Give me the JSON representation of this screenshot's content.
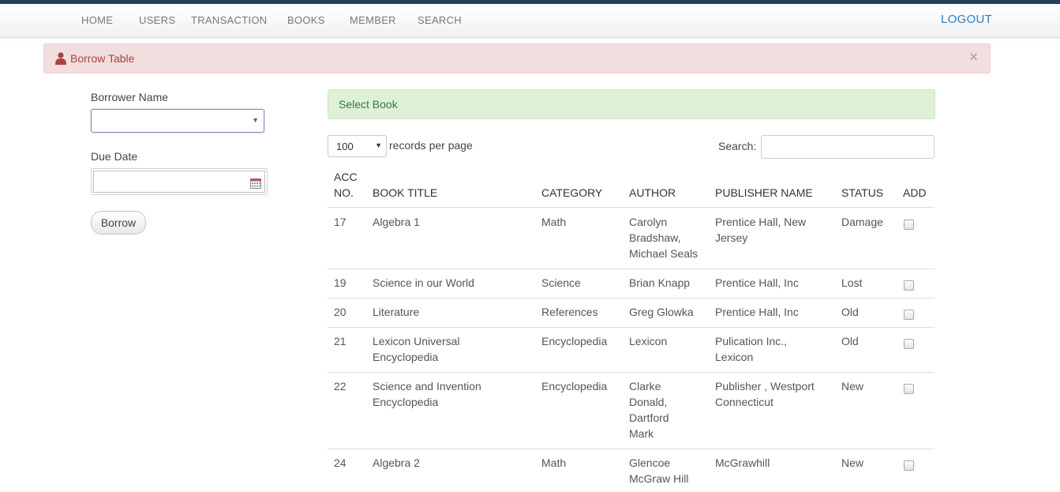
{
  "nav": {
    "home": "HOME",
    "users": "USERS",
    "transaction": "TRANSACTION",
    "books": "BOOKS",
    "member": "MEMBER",
    "search": "SEARCH",
    "logout": "LOGOUT"
  },
  "alert": {
    "title": "Borrow Table",
    "close": "×",
    "icon": "user-icon"
  },
  "form": {
    "borrower_label": "Borrower Name",
    "borrower_value": "",
    "due_label": "Due Date",
    "due_value": "",
    "borrow_button": "Borrow"
  },
  "select_book": {
    "title": "Select Book"
  },
  "table_controls": {
    "length_value": "100",
    "length_suffix": "records per page",
    "search_label": "Search:",
    "search_value": ""
  },
  "table": {
    "headers": {
      "acc_line1": "ACC",
      "acc_line2": "NO.",
      "title": "BOOK TITLE",
      "category": "CATEGORY",
      "author": "AUTHOR",
      "publisher": "PUBLISHER NAME",
      "status": "STATUS",
      "add": "ADD"
    },
    "rows": [
      {
        "acc": "17",
        "title": [
          "Algebra 1"
        ],
        "category": [
          "Math"
        ],
        "author": [
          "Carolyn",
          "Bradshaw,",
          "Michael Seals"
        ],
        "publisher": [
          "Prentice Hall, New",
          "Jersey"
        ],
        "status": "Damage",
        "checked": false
      },
      {
        "acc": "19",
        "title": [
          "Science in our World"
        ],
        "category": [
          "Science"
        ],
        "author": [
          "Brian Knapp"
        ],
        "publisher": [
          "Prentice Hall, Inc"
        ],
        "status": "Lost",
        "checked": false
      },
      {
        "acc": "20",
        "title": [
          "Literature"
        ],
        "category": [
          "References"
        ],
        "author": [
          "Greg Glowka"
        ],
        "publisher": [
          "Prentice Hall, Inc"
        ],
        "status": "Old",
        "checked": false
      },
      {
        "acc": "21",
        "title": [
          "Lexicon Universal",
          "Encyclopedia"
        ],
        "category": [
          "Encyclopedia"
        ],
        "author": [
          "Lexicon"
        ],
        "publisher": [
          "Pulication Inc.,",
          "Lexicon"
        ],
        "status": "Old",
        "checked": false
      },
      {
        "acc": "22",
        "title": [
          "Science and Invention",
          "Encyclopedia"
        ],
        "category": [
          "Encyclopedia"
        ],
        "author": [
          "Clarke",
          "Donald,",
          "Dartford",
          "Mark"
        ],
        "publisher": [
          "Publisher , Westport",
          "Connecticut"
        ],
        "status": "New",
        "checked": false
      },
      {
        "acc": "24",
        "title": [
          "Algebra 2"
        ],
        "category": [
          "Math"
        ],
        "author": [
          "Glencoe",
          "McGraw Hill"
        ],
        "publisher": [
          "McGrawhill"
        ],
        "status": "New",
        "checked": false
      }
    ]
  },
  "colors": {
    "navbar_top": "#23415e",
    "logout": "#2a7fc4",
    "alert_bg": "#f2dede",
    "alert_text": "#a94442",
    "success_bg": "#dff0d8",
    "success_text": "#3c763d"
  }
}
